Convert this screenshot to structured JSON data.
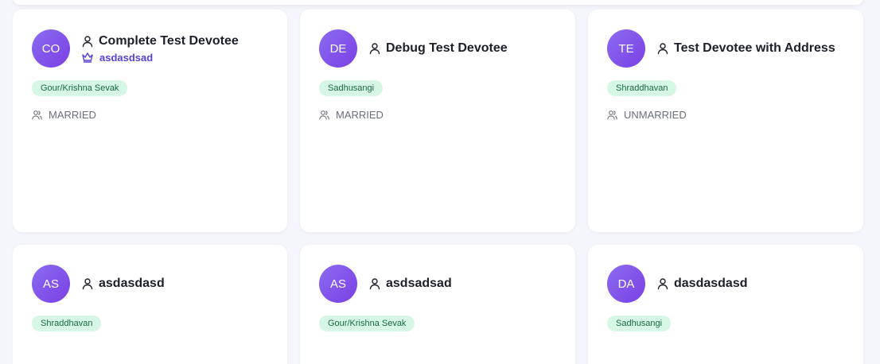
{
  "cards": [
    {
      "initials": "CO",
      "name": "Complete Test Devotee",
      "subtitle": "asdasdsad",
      "category": "Gour/Krishna Sevak",
      "marital_status": "MARRIED"
    },
    {
      "initials": "DE",
      "name": "Debug Test Devotee",
      "category": "Sadhusangi",
      "marital_status": "MARRIED"
    },
    {
      "initials": "TE",
      "name": "Test Devotee with Address",
      "category": "Shraddhavan",
      "marital_status": "UNMARRIED"
    },
    {
      "initials": "AS",
      "name": "asdasdasd",
      "category": "Shraddhavan"
    },
    {
      "initials": "AS",
      "name": "asdsadsad",
      "category": "Gour/Krishna Sevak"
    },
    {
      "initials": "DA",
      "name": "dasdasdasd",
      "category": "Sadhusangi"
    }
  ],
  "icons": {
    "person": "user-icon",
    "leader": "crown-icon",
    "marital": "users-icon"
  },
  "colors": {
    "avatar_gradient_start": "#8b6cf2",
    "avatar_gradient_end": "#7b3fe4",
    "tag_background": "#d7f7e6",
    "tag_text": "#176a3f",
    "accent": "#5b3fd6"
  }
}
